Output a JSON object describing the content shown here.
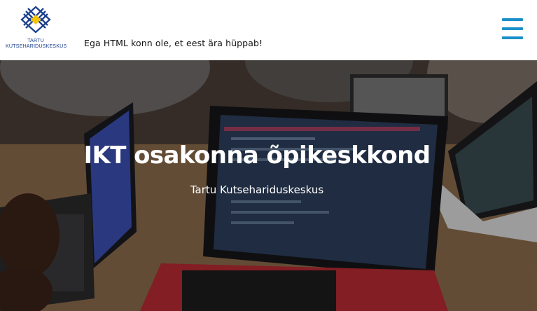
{
  "header": {
    "logo_line1": "TARTU",
    "logo_line2": "KUTSEHARIDUSKESKUS",
    "tagline": "Ega HTML konn ole, et eest ära hüppab!",
    "brand_blue": "#1b3f8c",
    "accent_yellow": "#f5c400",
    "menu_icon": "hamburger-menu-icon",
    "menu_color": "#1b8fc9"
  },
  "hero": {
    "title": "IKT osakonna õpikeskkond",
    "subtitle": "Tartu Kutsehariduskeskus"
  }
}
